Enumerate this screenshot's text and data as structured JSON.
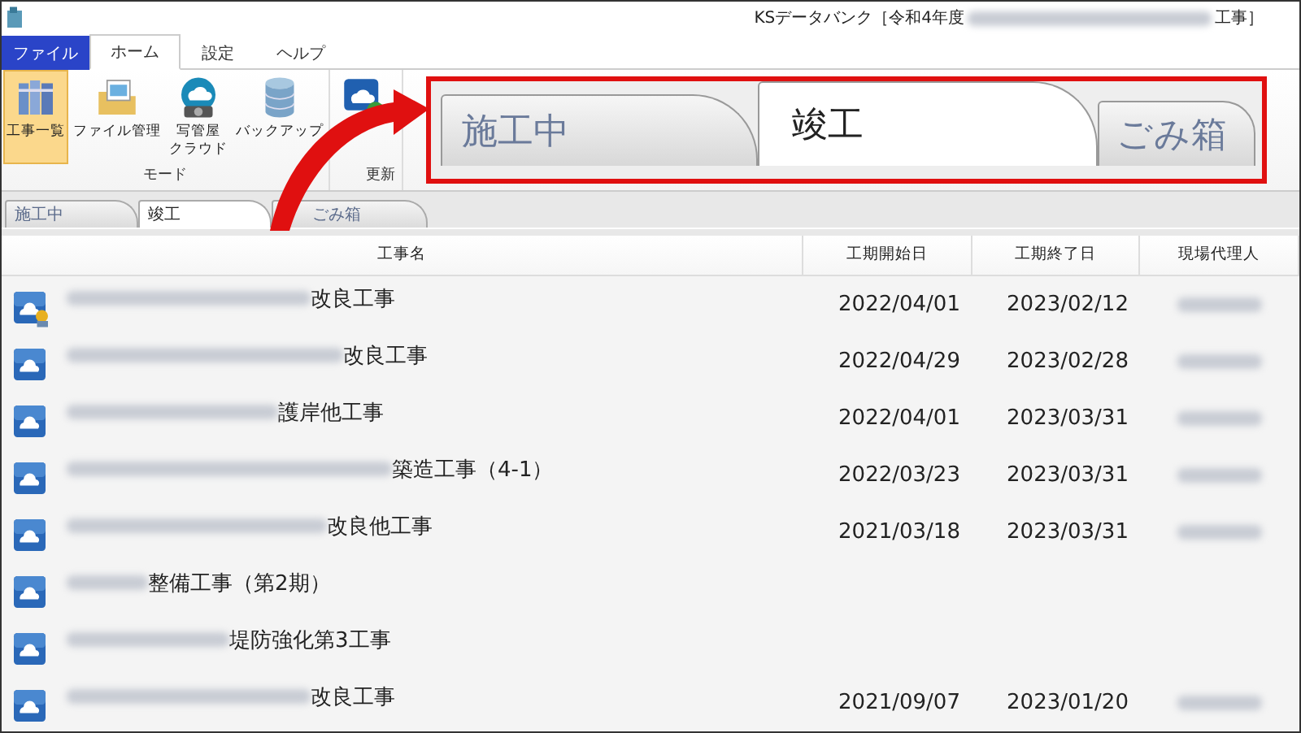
{
  "window": {
    "title_prefix": "KSデータバンク［令和4年度",
    "title_blurred": true,
    "title_suffix": "工事］"
  },
  "ribbon_tabs": [
    {
      "label": "ファイル",
      "kind": "file",
      "selected": false
    },
    {
      "label": "ホーム",
      "kind": "tab",
      "selected": true
    },
    {
      "label": "設定",
      "kind": "tab",
      "selected": false
    },
    {
      "label": "ヘルプ",
      "kind": "tab",
      "selected": false
    }
  ],
  "ribbon_groups": [
    {
      "label": "モード",
      "buttons": [
        {
          "label": "工事一覧",
          "selected": true
        },
        {
          "label": "ファイル管理",
          "selected": false
        },
        {
          "label": "写管屋",
          "label_line2": "クラウド",
          "selected": false
        },
        {
          "label": "バックアップ",
          "selected": false
        }
      ]
    },
    {
      "label": "更新",
      "buttons": [
        {
          "selected": false
        }
      ]
    }
  ],
  "document_tabs": [
    {
      "label": "施工中",
      "selected": false
    },
    {
      "label": "竣工",
      "selected": true
    },
    {
      "label": "ごみ箱",
      "selected": false
    }
  ],
  "callout": {
    "tabs": [
      {
        "label": "施工中",
        "selected": false
      },
      {
        "label": "竣工",
        "selected": true
      },
      {
        "label": "ごみ箱",
        "selected": false
      }
    ]
  },
  "table": {
    "columns": [
      "工事名",
      "工期開始日",
      "工期終了日",
      "現場代理人"
    ],
    "rows": [
      {
        "kind": "badge",
        "name_blurred": true,
        "name": "改良工事",
        "start": "2022/04/01",
        "end": "2023/02/12",
        "agent_blurred": true
      },
      {
        "kind": "plain",
        "name_blurred": true,
        "name": "改良工事",
        "start": "2022/04/29",
        "end": "2023/02/28",
        "agent_blurred": true
      },
      {
        "kind": "plain",
        "name_blurred": true,
        "name": "護岸他工事",
        "start": "2022/04/01",
        "end": "2023/03/31",
        "agent_blurred": true
      },
      {
        "kind": "plain",
        "name_blurred": true,
        "name": "築造工事（4-1）",
        "start": "2022/03/23",
        "end": "2023/03/31",
        "agent_blurred": true
      },
      {
        "kind": "plain",
        "name_blurred": true,
        "name": "改良他工事",
        "start": "2021/03/18",
        "end": "2023/03/31",
        "agent_blurred": true
      },
      {
        "kind": "plain",
        "name_blurred": true,
        "name": "整備工事（第2期）",
        "agent_blurred": false
      },
      {
        "kind": "plain",
        "name_blurred": true,
        "name": "堤防強化第3工事",
        "agent_blurred": false
      },
      {
        "kind": "plain",
        "name_blurred": true,
        "name": "改良工事",
        "start": "2021/09/07",
        "end": "2023/01/20",
        "agent_blurred": true
      }
    ]
  }
}
